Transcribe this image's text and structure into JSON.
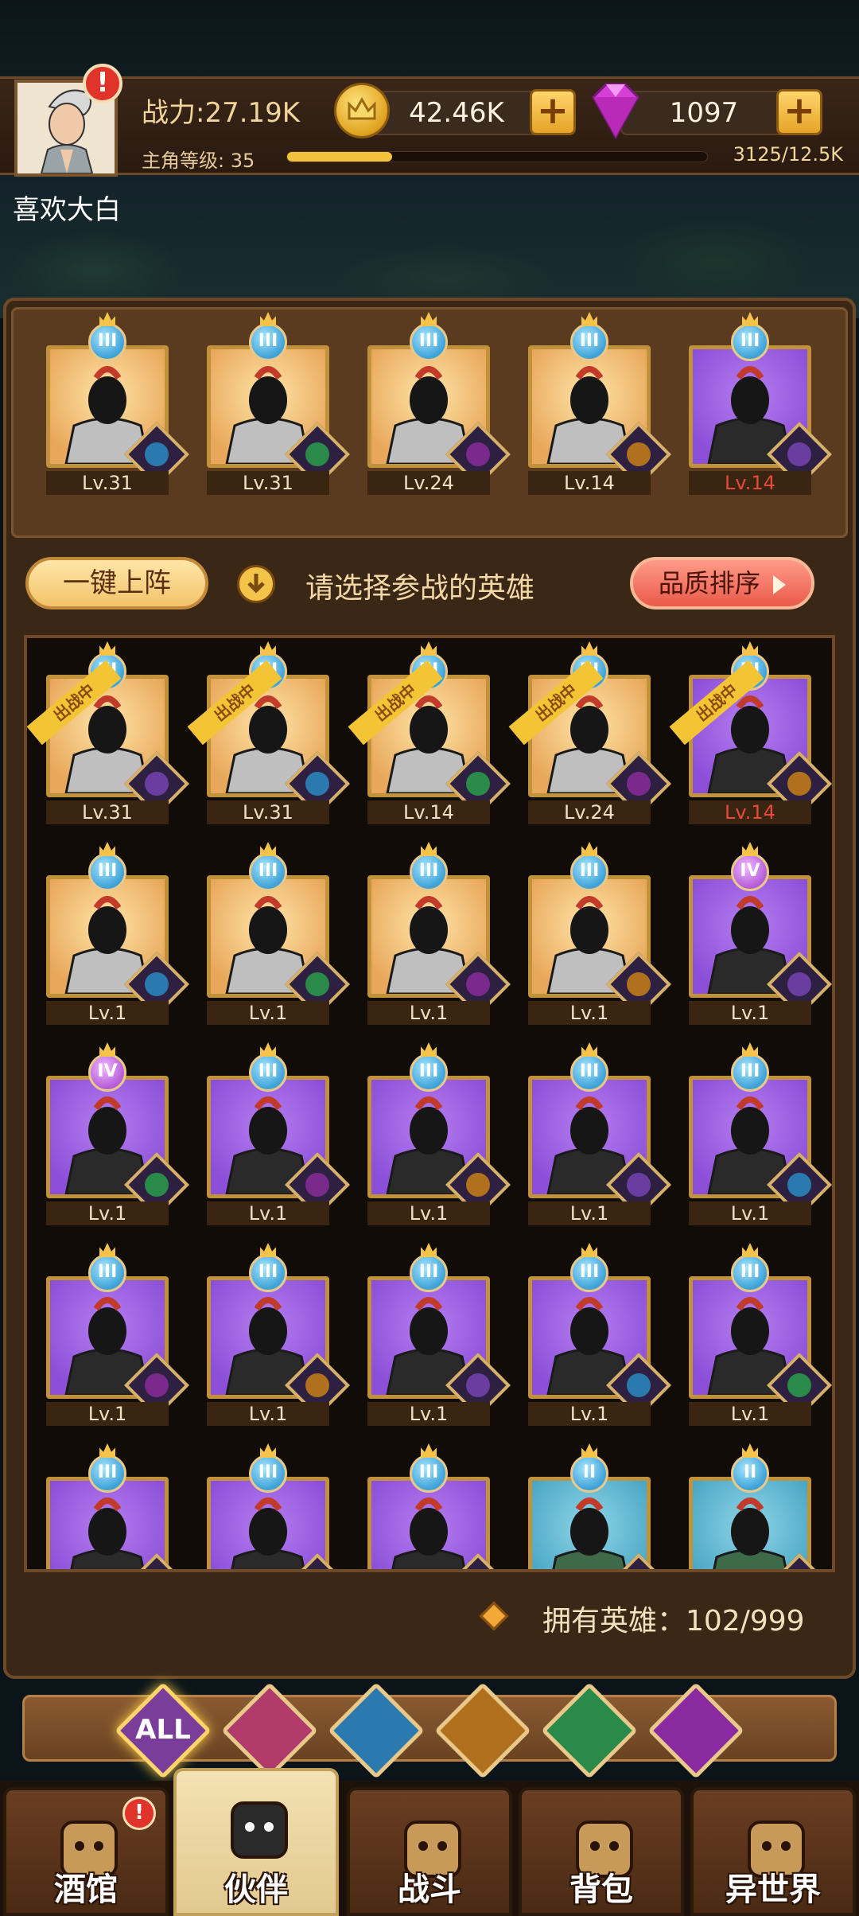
{
  "player": {
    "name": "喜欢大白",
    "power": "战力:27.19K",
    "level_label": "主角等级: 35",
    "exp_text": "3125/12.5K",
    "exp_progress": 0.25
  },
  "currency": {
    "gold": "42.46K",
    "gems": "1097",
    "add_symbol": "+"
  },
  "alerts": {
    "symbol": "!"
  },
  "team": [
    {
      "level": "Lv.31",
      "bg": "gold",
      "rank": "III",
      "red": false
    },
    {
      "level": "Lv.31",
      "bg": "gold",
      "rank": "III",
      "red": false
    },
    {
      "level": "Lv.24",
      "bg": "gold",
      "rank": "III",
      "red": false
    },
    {
      "level": "Lv.14",
      "bg": "gold",
      "rank": "III",
      "red": false
    },
    {
      "level": "Lv.14",
      "bg": "purple",
      "rank": "III",
      "red": true
    }
  ],
  "actions": {
    "one_click": "一键上阵",
    "select_prompt": "请选择参战的英雄",
    "sort": "品质排序"
  },
  "roster": {
    "in_battle_label": "出战中",
    "heroes": [
      {
        "level": "Lv.31",
        "bg": "gold",
        "rank": "III",
        "deployed": true,
        "red": false
      },
      {
        "level": "Lv.31",
        "bg": "gold",
        "rank": "III",
        "deployed": true,
        "red": false
      },
      {
        "level": "Lv.14",
        "bg": "gold",
        "rank": "III",
        "deployed": true,
        "red": false
      },
      {
        "level": "Lv.24",
        "bg": "gold",
        "rank": "III",
        "deployed": true,
        "red": false
      },
      {
        "level": "Lv.14",
        "bg": "purple",
        "rank": "III",
        "deployed": true,
        "red": true
      },
      {
        "level": "Lv.1",
        "bg": "gold",
        "rank": "III",
        "deployed": false,
        "red": false
      },
      {
        "level": "Lv.1",
        "bg": "gold",
        "rank": "III",
        "deployed": false,
        "red": false
      },
      {
        "level": "Lv.1",
        "bg": "gold",
        "rank": "III",
        "deployed": false,
        "red": false
      },
      {
        "level": "Lv.1",
        "bg": "gold",
        "rank": "III",
        "deployed": false,
        "red": false
      },
      {
        "level": "Lv.1",
        "bg": "purple",
        "rank": "IV",
        "deployed": false,
        "red": false
      },
      {
        "level": "Lv.1",
        "bg": "purple",
        "rank": "IV",
        "deployed": false,
        "red": false
      },
      {
        "level": "Lv.1",
        "bg": "purple",
        "rank": "III",
        "deployed": false,
        "red": false
      },
      {
        "level": "Lv.1",
        "bg": "purple",
        "rank": "III",
        "deployed": false,
        "red": false
      },
      {
        "level": "Lv.1",
        "bg": "purple",
        "rank": "III",
        "deployed": false,
        "red": false
      },
      {
        "level": "Lv.1",
        "bg": "purple",
        "rank": "III",
        "deployed": false,
        "red": false
      },
      {
        "level": "Lv.1",
        "bg": "purple",
        "rank": "III",
        "deployed": false,
        "red": false
      },
      {
        "level": "Lv.1",
        "bg": "purple",
        "rank": "III",
        "deployed": false,
        "red": false
      },
      {
        "level": "Lv.1",
        "bg": "purple",
        "rank": "III",
        "deployed": false,
        "red": false
      },
      {
        "level": "Lv.1",
        "bg": "purple",
        "rank": "III",
        "deployed": false,
        "red": false
      },
      {
        "level": "Lv.1",
        "bg": "purple",
        "rank": "III",
        "deployed": false,
        "red": false
      },
      {
        "level": "",
        "bg": "purple",
        "rank": "III",
        "deployed": false,
        "red": false
      },
      {
        "level": "",
        "bg": "purple",
        "rank": "III",
        "deployed": false,
        "red": false
      },
      {
        "level": "",
        "bg": "purple",
        "rank": "III",
        "deployed": false,
        "red": false
      },
      {
        "level": "",
        "bg": "teal",
        "rank": "II",
        "deployed": false,
        "red": false
      },
      {
        "level": "",
        "bg": "teal",
        "rank": "II",
        "deployed": false,
        "red": false
      }
    ]
  },
  "owned": {
    "text": "拥有英雄：102/999"
  },
  "filters": [
    {
      "name": "all",
      "label": "ALL",
      "color": "#7a3e9a",
      "active": true
    },
    {
      "name": "human",
      "label": "",
      "color": "#b03a6a",
      "active": false
    },
    {
      "name": "fishman",
      "label": "",
      "color": "#2a7ab0",
      "active": false
    },
    {
      "name": "beast",
      "label": "",
      "color": "#b0701e",
      "active": false
    },
    {
      "name": "elf",
      "label": "",
      "color": "#2a8a4a",
      "active": false
    },
    {
      "name": "demon",
      "label": "",
      "color": "#8a2aa0",
      "active": false
    }
  ],
  "nav": [
    {
      "name": "tavern",
      "label": "酒馆",
      "active": false
    },
    {
      "name": "partner",
      "label": "伙伴",
      "active": true
    },
    {
      "name": "battle",
      "label": "战斗",
      "active": false
    },
    {
      "name": "bag",
      "label": "背包",
      "active": false
    },
    {
      "name": "otherworld",
      "label": "异世界",
      "active": false
    }
  ],
  "colors": {
    "gold_card": "#e8a75a",
    "purple_card": "#8b4fd8",
    "teal_card": "#4aa6c4",
    "level_red": "#e84a3a"
  }
}
